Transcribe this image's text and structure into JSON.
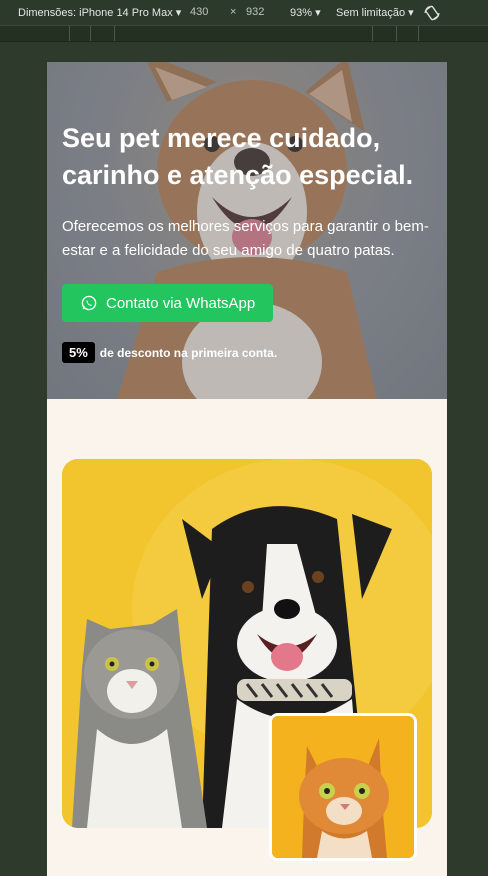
{
  "devtools": {
    "dimensions_label": "Dimensões: iPhone 14 Pro Max",
    "width": "430",
    "times": "×",
    "height": "932",
    "zoom": "93%",
    "throttle": "Sem limitação",
    "rotate_icon": "rotate-icon"
  },
  "hero": {
    "title": "Seu pet merece cuidado, carinho e atenção especial.",
    "subtitle": "Oferecemos os melhores serviços para garantir o bem-estar e a felicidade do seu amigo de quatro patas.",
    "cta_label": "Contato via WhatsApp",
    "cta_icon": "whatsapp-icon",
    "discount_badge": "5%",
    "discount_text": "de desconto na primeira conta."
  },
  "colors": {
    "cta_green": "#22c55e",
    "page_bg": "#fbf4ec",
    "photo_yellow": "#f2c42e"
  }
}
